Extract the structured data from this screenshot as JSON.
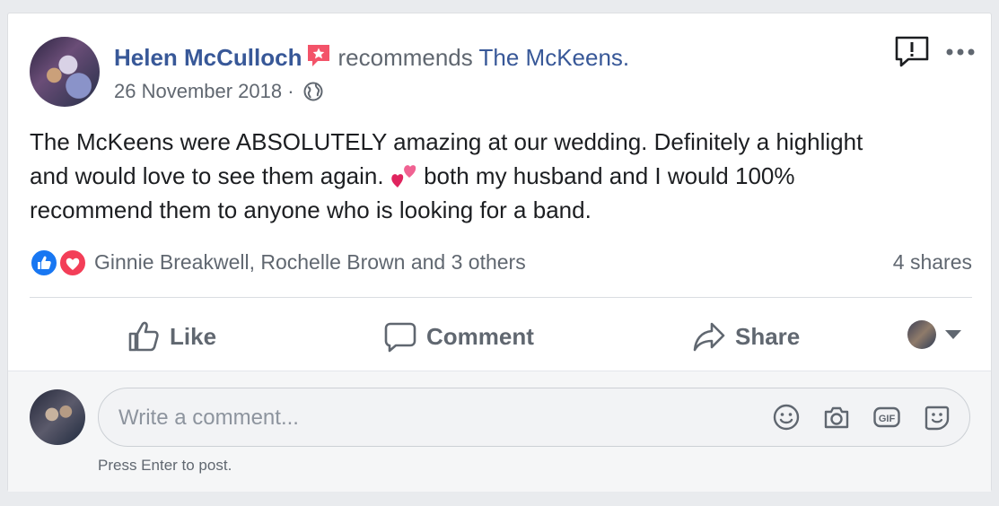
{
  "post": {
    "author": "Helen McCulloch",
    "action": "recommends",
    "page": "The McKeens.",
    "date": "26 November 2018",
    "separator": "·",
    "text_lines": [
      "The McKeens were ABSOLUTELY amazing at our wedding. Definitely a highlight",
      "and would love to see them again.",
      "both my husband and I would 100%",
      "recommend them to anyone who is looking for a band."
    ],
    "reactors": "Ginnie Breakwell, Rochelle Brown and 3 others",
    "shares": "4 shares"
  },
  "actions": {
    "like": "Like",
    "comment": "Comment",
    "share": "Share"
  },
  "comment_box": {
    "placeholder": "Write a comment...",
    "hint": "Press Enter to post."
  },
  "icons": {
    "recommend_badge": "star-speech-bubble-icon",
    "privacy": "globe-icon",
    "report": "report-icon",
    "more": "more-options-icon",
    "emoji_in_text": "two-hearts-icon",
    "reactions": [
      "like-reaction-icon",
      "love-reaction-icon"
    ],
    "input": [
      "emoji-icon",
      "camera-icon",
      "gif-icon",
      "sticker-icon"
    ]
  },
  "colors": {
    "link": "#385898",
    "secondary_text": "#606770",
    "like_blue": "#1877f2",
    "love_red": "#f33e58",
    "badge_red": "#f35369"
  }
}
